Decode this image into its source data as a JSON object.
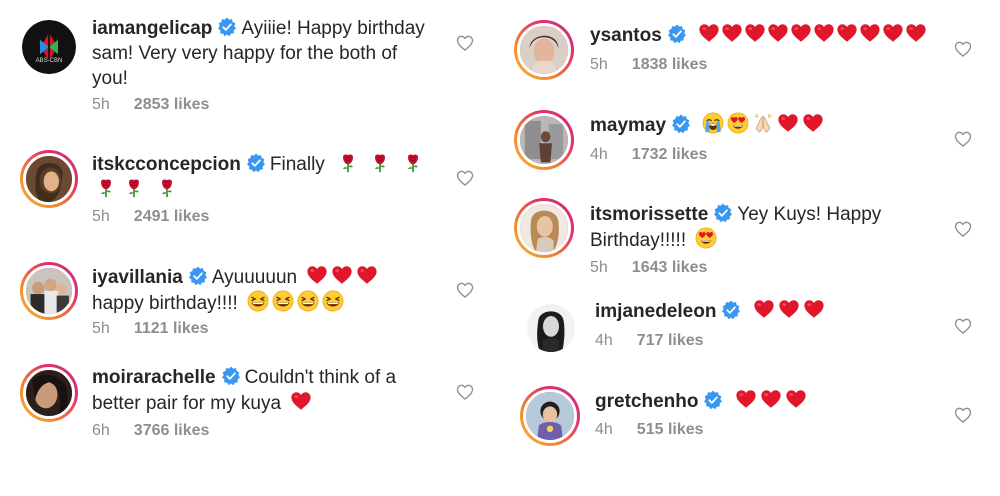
{
  "comments_left": [
    {
      "username": "iamangelicap",
      "text": "Ayiiie! Happy birthday sam! Very very happy for the both of you!",
      "time": "5h",
      "likes": "2853 likes"
    },
    {
      "username": "itskcconcepcion",
      "text": "Finally",
      "time": "5h",
      "likes": "2491 likes"
    },
    {
      "username": "iyavillania",
      "text_a": "Ayuuuuun",
      "text_b": "happy birthday!!!!",
      "time": "5h",
      "likes": "1121 likes"
    },
    {
      "username": "moirarachelle",
      "text": "Couldn't think of a better pair for my kuya",
      "time": "6h",
      "likes": "3766 likes"
    }
  ],
  "comments_right": [
    {
      "username": "ysantos",
      "time": "5h",
      "likes": "1838 likes"
    },
    {
      "username": "maymay",
      "time": "4h",
      "likes": "1732 likes"
    },
    {
      "username": "itsmorissette",
      "text": "Yey Kuys! Happy Birthday!!!!!",
      "time": "5h",
      "likes": "1643 likes"
    },
    {
      "username": "imjanedeleon",
      "time": "4h",
      "likes": "717 likes"
    },
    {
      "username": "gretchenho",
      "time": "4h",
      "likes": "515 likes"
    }
  ],
  "avatar_logo_text": "ABS-CBN",
  "icons": {
    "verified": "verified-badge-icon",
    "like": "heart-outline-icon",
    "red_heart": "red-heart-emoji",
    "rose": "rose-emoji",
    "laugh": "grinning-squinting-emoji",
    "crying": "loudly-crying-emoji",
    "heart_eyes": "heart-eyes-emoji",
    "praying": "folded-hands-emoji"
  },
  "colors": {
    "username": "#262626",
    "meta": "#8e8e8e",
    "verified": "#3897f0",
    "heart_emoji": "#e0162b"
  }
}
